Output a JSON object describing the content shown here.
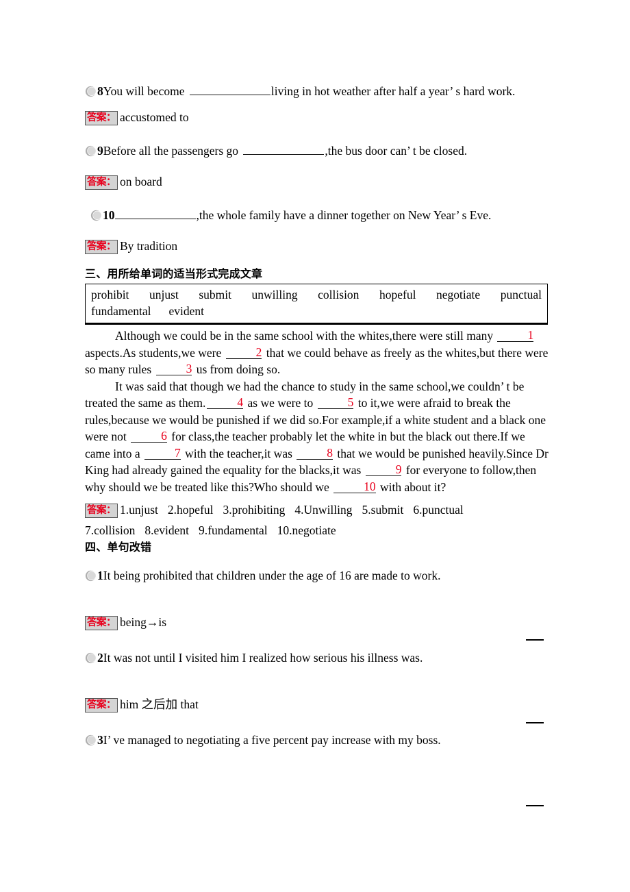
{
  "bullet_icon": "crescent-bullet-icon",
  "answer_label": "答案：",
  "fill_in_questions": [
    {
      "number": "8",
      "text_before": "You will become ",
      "text_after": "living in hot weather after half a year’ s hard work.",
      "answer": "accustomed to"
    },
    {
      "number": "9",
      "text_before": "Before all the passengers go ",
      "text_after": ",the bus door can’ t be closed.",
      "answer": "on board"
    },
    {
      "number": "10",
      "text_before": "",
      "text_after": ",the whole family have a dinner together on New Year’ s Eve.",
      "answer": "By tradition"
    }
  ],
  "section_three": {
    "heading": "三、用所给单词的适当形式完成文章",
    "word_bank_row1": [
      "prohibit",
      "unjust",
      "submit",
      "unwilling",
      "collision",
      "hopeful",
      "negotiate",
      "punctual"
    ],
    "word_bank_row2": [
      "fundamental",
      "evident"
    ],
    "passage": {
      "p1_a": "Although we could be in the same school with the whites,there were still many ",
      "p1_b1": "1",
      "p1_c": " aspects.As students,we were ",
      "p1_b2": "2",
      "p1_d": " that we could behave as freely as the whites,but there were so many rules ",
      "p1_b3": "3",
      "p1_e": " us from doing so.",
      "p2_a": "It was said that though we had the chance to study in the same school,we couldn’ t be treated the same as them.",
      "p2_b4": "4",
      "p2_c": " as we were to ",
      "p2_b5": "5",
      "p2_d": " to it,we were afraid to break the rules,because we would be punished if we did so.For example,if a white student and a black one were not ",
      "p2_b6": "6",
      "p2_e": " for class,the teacher probably let the white in but the black out there.If we came into a ",
      "p2_b7": "7",
      "p2_f": " with the teacher,it was ",
      "p2_b8": "8",
      "p2_g": " that we would be punished heavily.Since Dr King had already gained the equality for the blacks,it was ",
      "p2_b9": "9",
      "p2_h": " for everyone to follow,then why should we be treated like this?Who should we ",
      "p2_b10": "10",
      "p2_i": " with about it?"
    },
    "answers_line1": [
      "1.unjust",
      "2.hopeful",
      "3.prohibiting",
      "4.Unwilling",
      "5.submit",
      "6.punctual"
    ],
    "answers_line2": [
      "7.collision",
      "8.evident",
      "9.fundamental",
      "10.negotiate"
    ]
  },
  "section_four": {
    "heading": "四、单句改错",
    "questions": [
      {
        "number": "1",
        "text": "It being prohibited that children under the age of 16 are made to work.",
        "answer": "being→is"
      },
      {
        "number": "2",
        "text": "It was not until I visited him I realized how serious his illness was.",
        "answer": "him 之后加 that"
      },
      {
        "number": "3",
        "text": "I’ ve managed to negotiating a five percent pay increase with my boss.",
        "answer": ""
      }
    ]
  },
  "colors": {
    "answer_red": "#e8001c",
    "answer_tag_bg": "#d4d4d4",
    "bullet_gray": "#b8b8b8",
    "text_black": "#000000"
  }
}
